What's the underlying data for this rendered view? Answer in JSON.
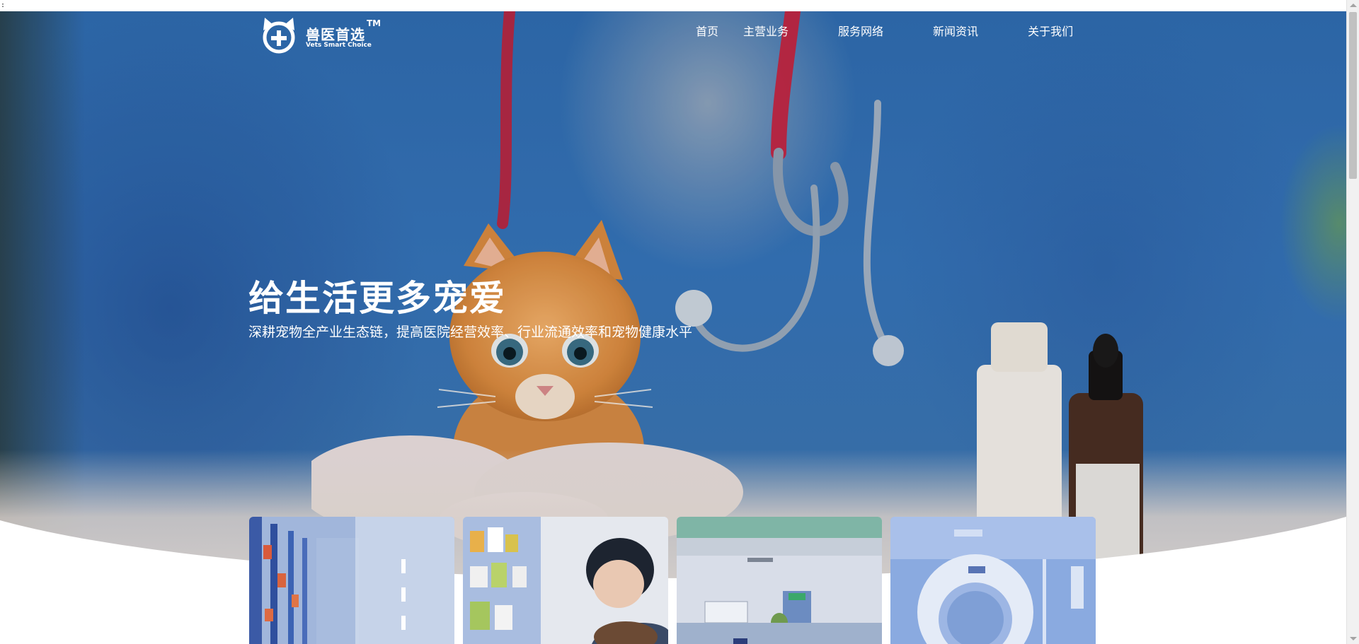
{
  "brand": {
    "name": "兽医首选",
    "trademark": "TM",
    "subtitle": "Vets Smart Choice"
  },
  "nav": {
    "items": [
      {
        "label": "首页"
      },
      {
        "label": "主营业务"
      },
      {
        "label": "服务网络"
      },
      {
        "label": "新闻资讯"
      },
      {
        "label": "关于我们"
      }
    ]
  },
  "hero": {
    "title": "给生活更多宠爱",
    "subtitle": "深耕宠物全产业生态链，提高医院经营效率、行业流通效率和宠物健康水平"
  },
  "cards": [
    {
      "image": "warehouse-shelves-photo"
    },
    {
      "image": "pet-store-man-with-dog-photo"
    },
    {
      "image": "hospital-hallway-photo"
    },
    {
      "image": "ct-scanner-photo"
    }
  ],
  "corner_text": ":",
  "colors": {
    "hero_scrubs_blue": "#3573b8",
    "text_white": "#ffffff",
    "card_tint_blue": "#7f9fd6",
    "background": "#ffffff"
  }
}
